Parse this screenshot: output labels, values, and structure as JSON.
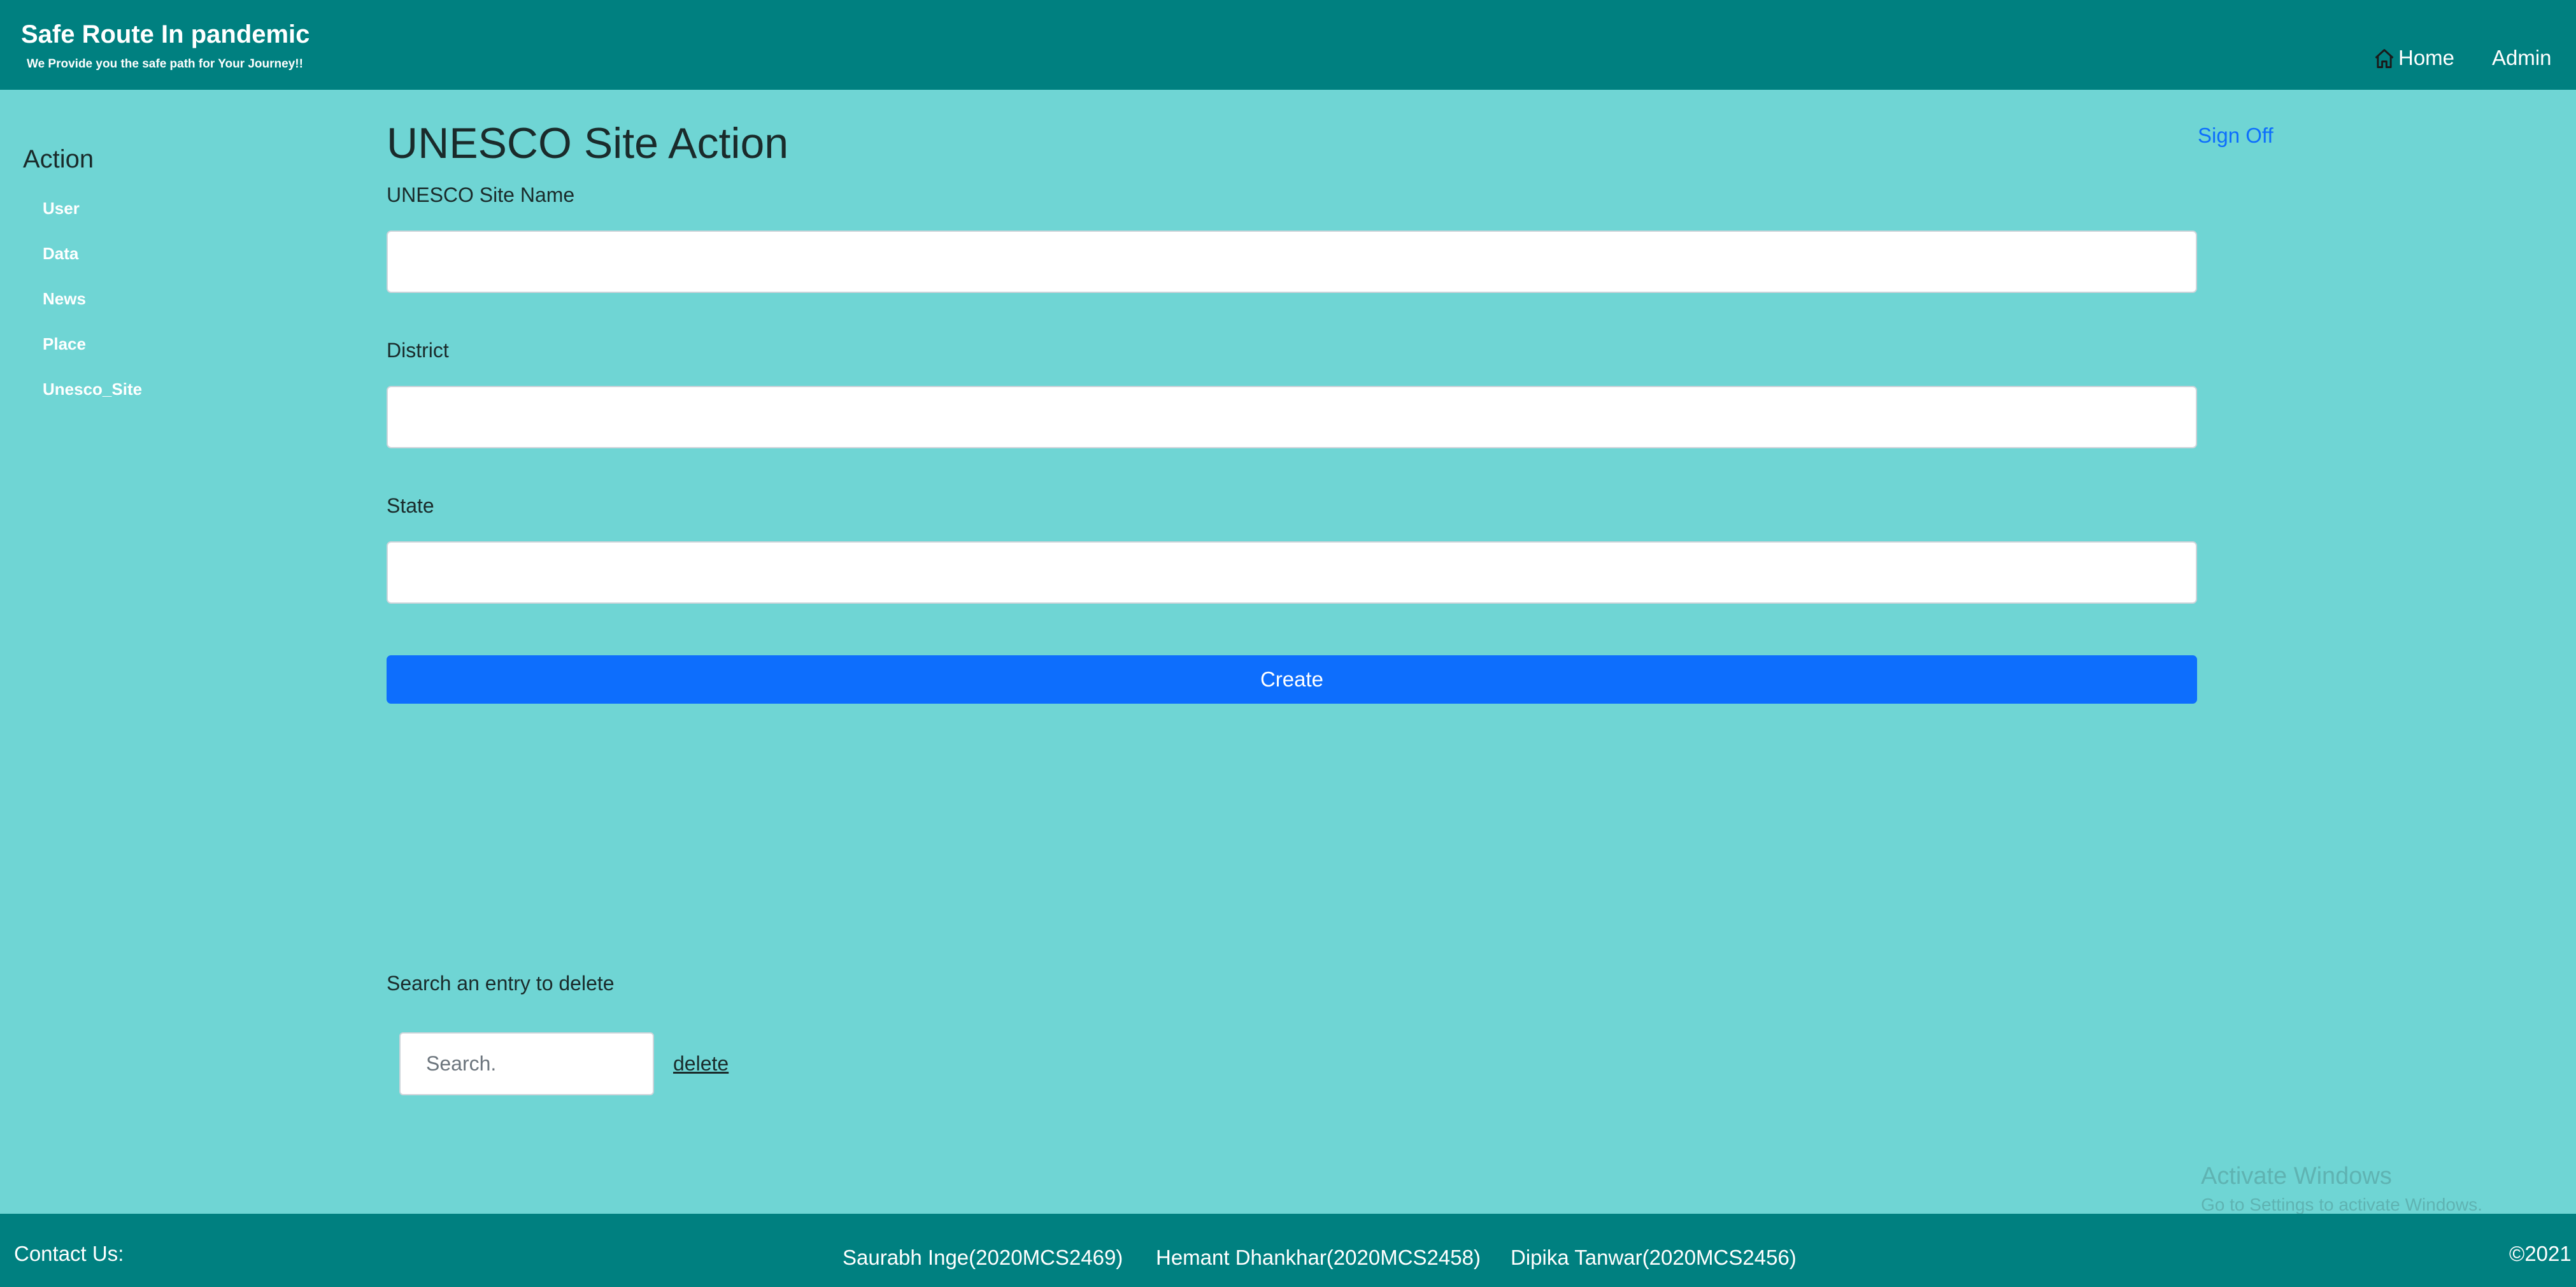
{
  "header": {
    "title": "Safe Route In pandemic",
    "tagline": "We Provide you the safe path for Your Journey!!",
    "nav": {
      "home_label": "Home",
      "admin_label": "Admin",
      "home_icon": "home-icon"
    }
  },
  "sidebar": {
    "title": "Action",
    "items": [
      {
        "label": "User"
      },
      {
        "label": "Data"
      },
      {
        "label": "News"
      },
      {
        "label": "Place"
      },
      {
        "label": "Unesco_Site"
      }
    ]
  },
  "main": {
    "title": "UNESCO Site Action",
    "sign_off_label": "Sign Off",
    "fields": [
      {
        "label": "UNESCO Site Name",
        "value": ""
      },
      {
        "label": "District",
        "value": ""
      },
      {
        "label": "State",
        "value": ""
      }
    ],
    "create_label": "Create",
    "delete_section": {
      "label": "Search an entry to delete",
      "search_placeholder": "Search.",
      "delete_label": "delete"
    }
  },
  "watermark": {
    "title": "Activate Windows",
    "subtitle": "Go to Settings to activate Windows."
  },
  "footer": {
    "contact_label": "Contact Us:",
    "members": [
      "Saurabh Inge(2020MCS2469)",
      "Hemant Dhankhar(2020MCS2458)",
      "Dipika Tanwar(2020MCS2456)"
    ],
    "copyright": "©2021"
  },
  "colors": {
    "header_bg": "#008080",
    "page_bg": "#6fd5d4",
    "primary": "#0d6efd",
    "link": "#0d6efd"
  }
}
